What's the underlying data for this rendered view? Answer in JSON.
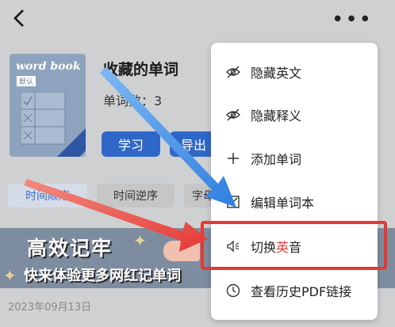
{
  "book": {
    "cover_title": "word book",
    "cover_tag": "默认",
    "title": "收藏的单词",
    "count_label": "单词数：3"
  },
  "buttons": {
    "study": "学习",
    "export": "导出"
  },
  "sort_chips": {
    "time_asc": "时间顺序",
    "time_desc": "时间逆序",
    "alpha_partial": "字母"
  },
  "banner": {
    "headline": "高效记牢",
    "subline": "快来体验更多网红记单词"
  },
  "date": "2023年09月13日",
  "menu": {
    "items": [
      {
        "label": "隐藏英文",
        "icon": "eye-off-icon"
      },
      {
        "label": "隐藏释义",
        "icon": "eye-off-icon"
      },
      {
        "label": "添加单词",
        "icon": "plus-icon"
      },
      {
        "label": "编辑单词本",
        "icon": "edit-icon"
      },
      {
        "label_before": "切换",
        "label_highlight": "英",
        "label_after": "音",
        "icon": "speaker-icon"
      },
      {
        "label": "查看历史PDF链接",
        "icon": "clock-icon"
      }
    ]
  },
  "colors": {
    "accent_blue": "#2f67c8",
    "highlight_red": "#e53935",
    "arrow_blue": "#3d8fe6"
  }
}
